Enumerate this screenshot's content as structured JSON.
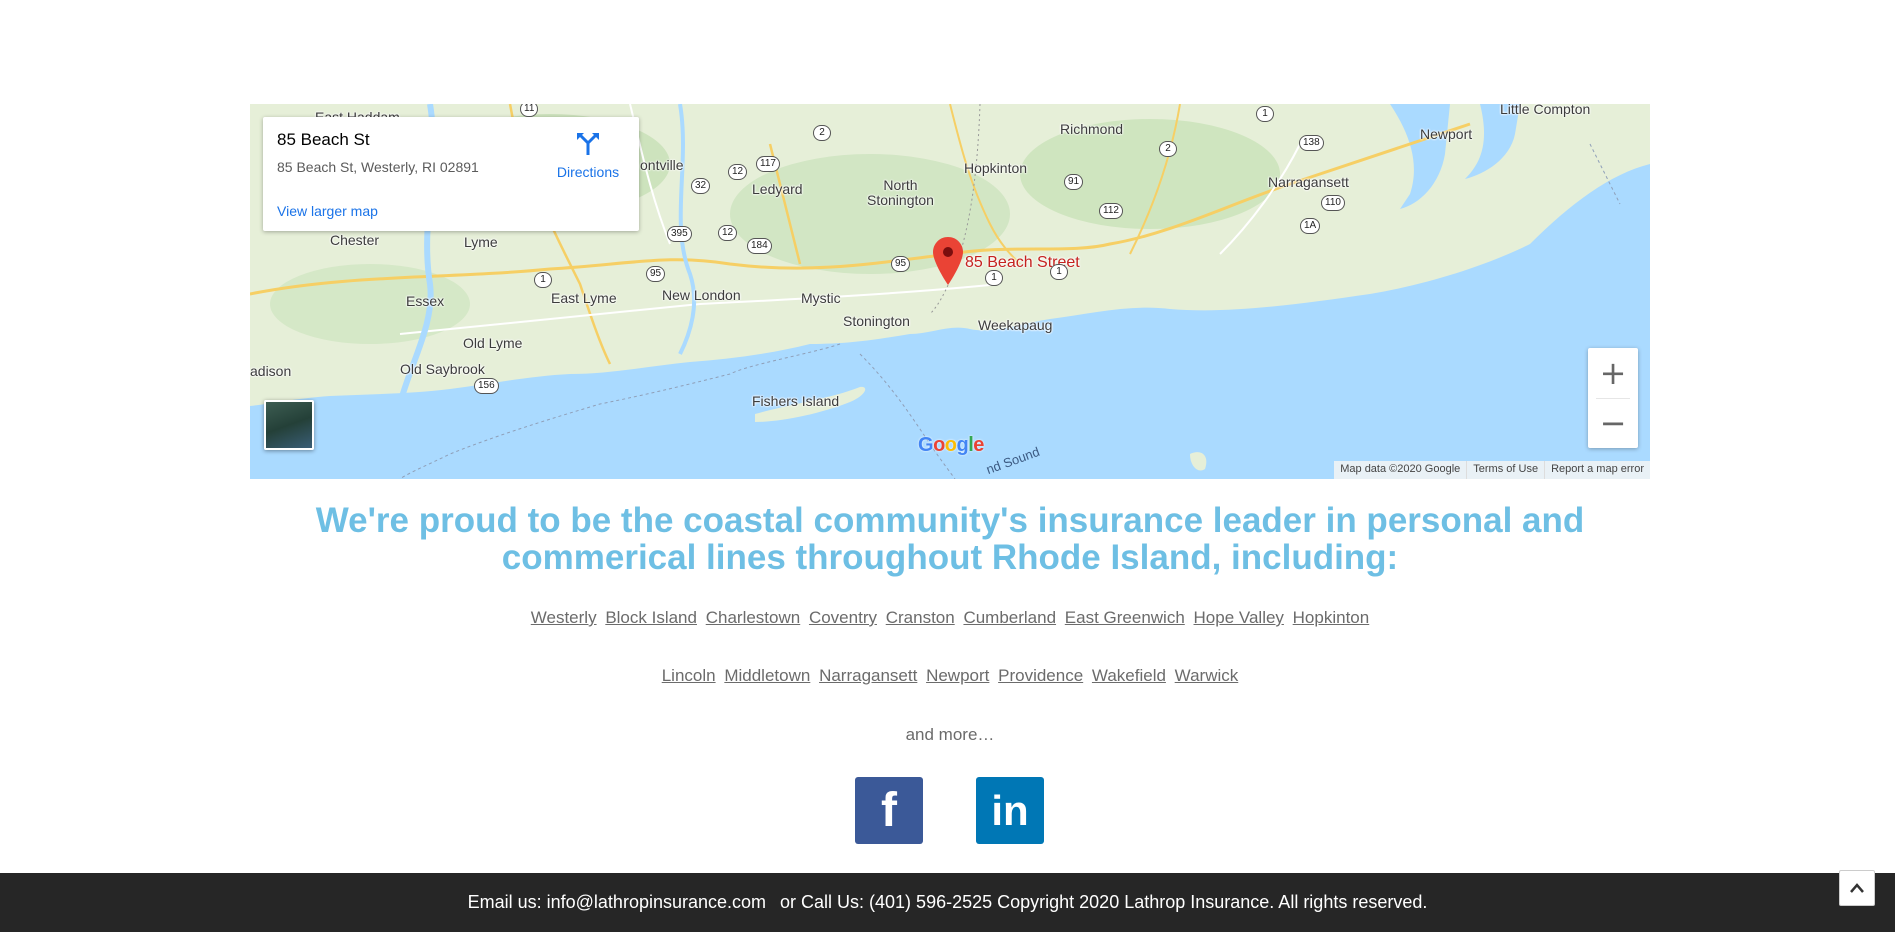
{
  "map": {
    "info_card": {
      "title": "85 Beach St",
      "address": "85 Beach St, Westerly, RI 02891",
      "directions_label": "Directions",
      "larger_map_label": "View larger map"
    },
    "pin_label": "85 Beach Street",
    "places": {
      "east_haddam": "East Haddam",
      "montville": "ontville",
      "ledyard": "Ledyard",
      "north_stonington": "North\nStonington",
      "richmond": "Richmond",
      "hopkinton": "Hopkinton",
      "little_compton": "Little Compton",
      "newport": "Newport",
      "narragansett": "Narragansett",
      "chester": "Chester",
      "lyme": "Lyme",
      "essex": "Essex",
      "east_lyme": "East Lyme",
      "new_london": "New London",
      "mystic": "Mystic",
      "stonington": "Stonington",
      "weekapaug": "Weekapaug",
      "old_lyme": "Old Lyme",
      "old_saybrook": "Old Saybrook",
      "madison": "adison",
      "fishers_island": "Fishers Island",
      "sound": "nd Sound"
    },
    "route_shields": [
      "11",
      "2",
      "117",
      "12",
      "32",
      "395",
      "12",
      "184",
      "95",
      "95",
      "1",
      "1",
      "1",
      "156",
      "2",
      "138",
      "91",
      "112",
      "110",
      "1A",
      "1"
    ],
    "zoom_in": "+",
    "zoom_out": "−",
    "google_logo": "Google",
    "footer": {
      "data": "Map data ©2020 Google",
      "terms": "Terms of Use",
      "report": "Report a map error"
    }
  },
  "content": {
    "headline": "We're proud to be the coastal community's insurance leader in personal and commerical lines throughout Rhode Island, including:",
    "towns_row1": [
      "Westerly",
      "Block Island",
      "Charlestown",
      "Coventry",
      "Cranston",
      "Cumberland",
      "East Greenwich",
      "Hope Valley",
      "Hopkinton"
    ],
    "towns_row2": [
      "Lincoln",
      "Middletown",
      "Narragansett",
      "Newport",
      "Providence",
      "Wakefield",
      "Warwick"
    ],
    "and_more": "and more…",
    "social": {
      "facebook": "f",
      "linkedin": "in"
    }
  },
  "footer": {
    "email": "Email us: info@lathropinsurance.com",
    "rest": "or Call Us: (401) 596-2525 Copyright 2020 Lathrop Insurance. All rights reserved."
  },
  "colors": {
    "headline": "#6ebfe4",
    "facebook": "#3b5998",
    "linkedin": "#0077b5",
    "footer_bg": "#262626",
    "water": "#aadaff",
    "land": "#e8f0de",
    "pin": "#ea4335"
  }
}
